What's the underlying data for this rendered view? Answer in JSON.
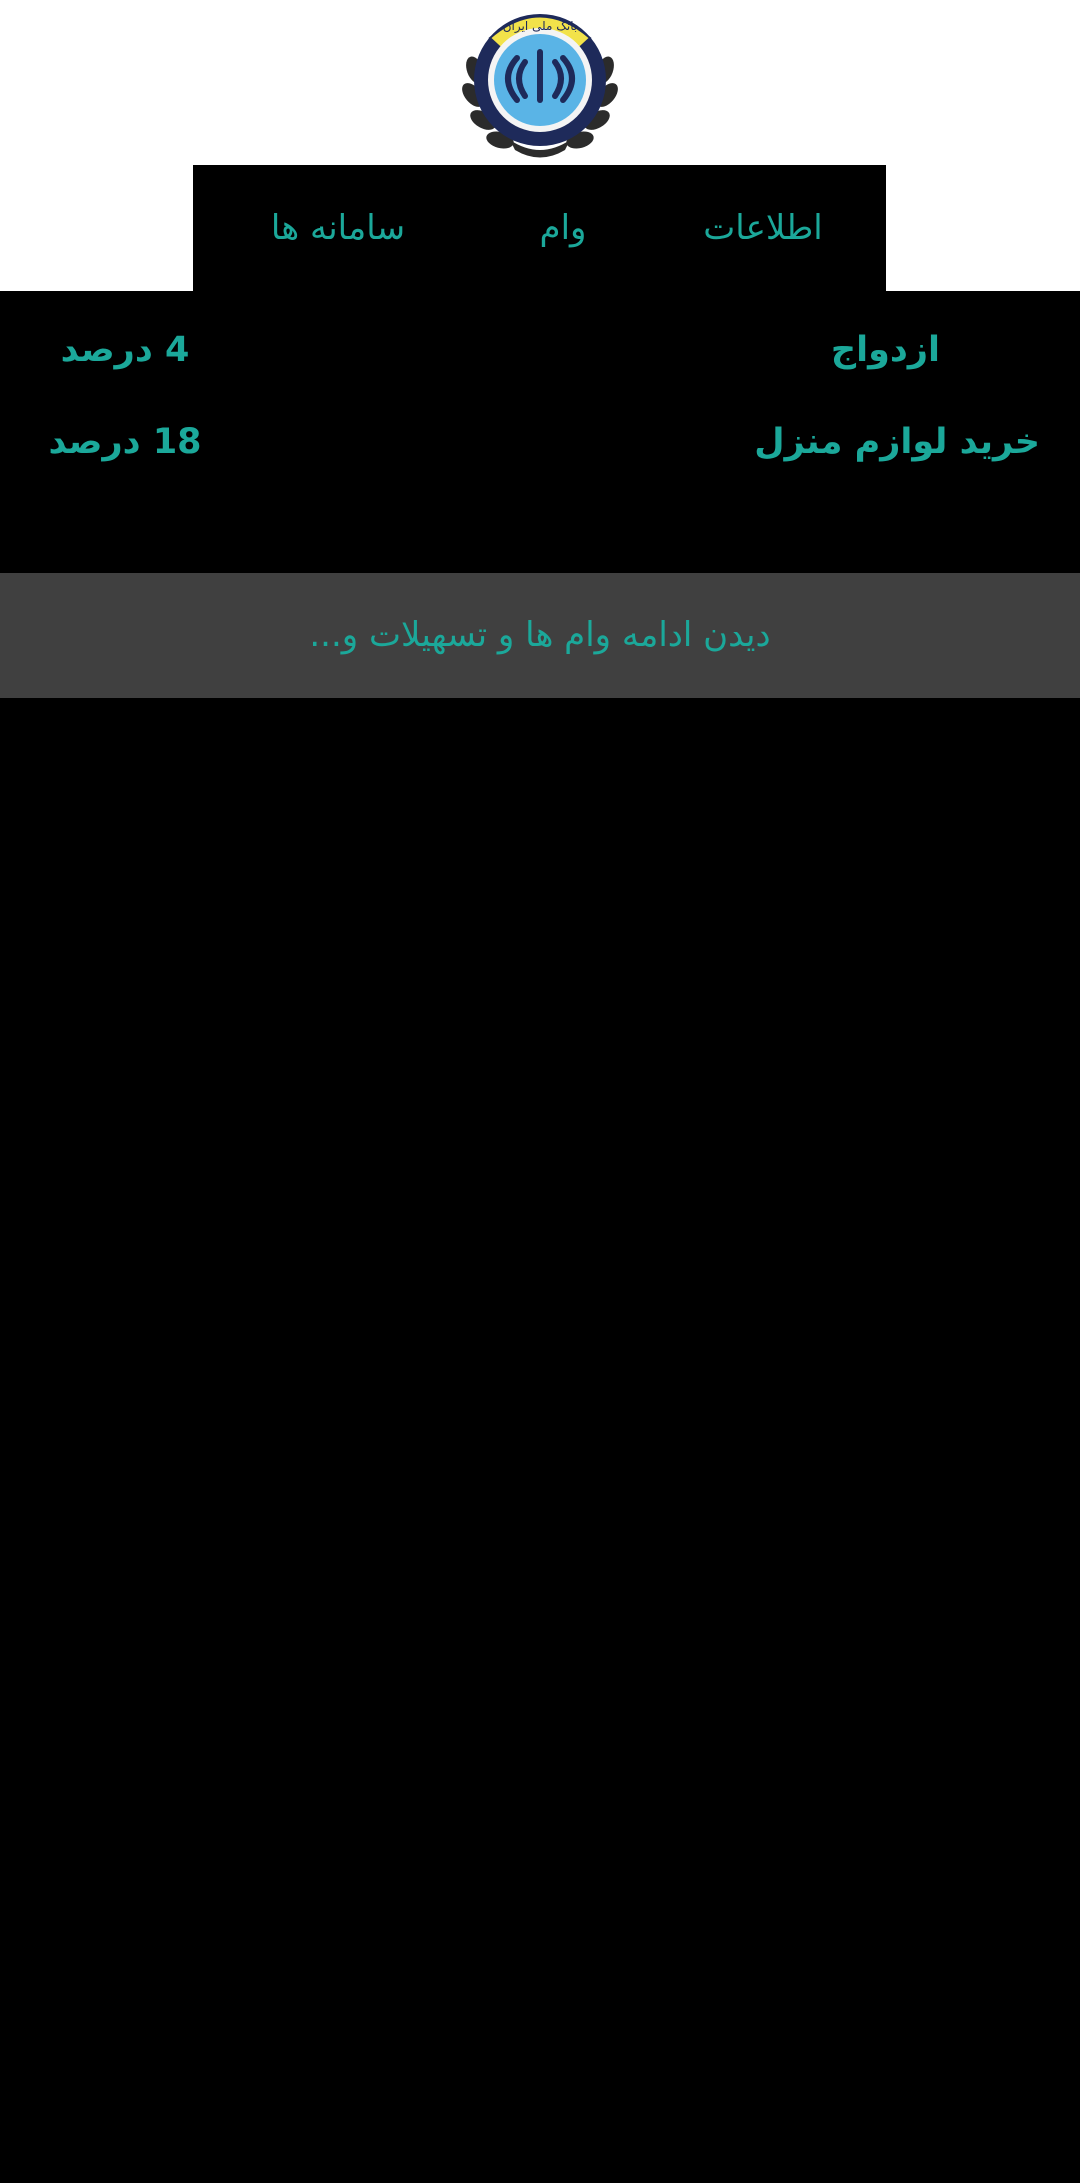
{
  "header": {
    "logo_icon": "bank-melli-emblem-icon",
    "logo_text": "بانک ملی ایران"
  },
  "tabs": [
    {
      "label": "اطلاعات"
    },
    {
      "label": "وام"
    },
    {
      "label": "سامانه ها"
    }
  ],
  "loans": [
    {
      "name": "ازدواج",
      "rate": "4 درصد"
    },
    {
      "name": "خرید لوازم منزل",
      "rate": "18 درصد"
    }
  ],
  "more_button": {
    "label": "دیدن ادامه وام ها و تسهیلات و..."
  },
  "colors": {
    "accent": "#1ba89a",
    "background": "#000000",
    "header_bg": "#ffffff",
    "more_bar_bg": "#404040",
    "logo_blue": "#5ab4e6",
    "logo_yellow": "#f2e24a",
    "logo_navy": "#1e2a5a"
  }
}
